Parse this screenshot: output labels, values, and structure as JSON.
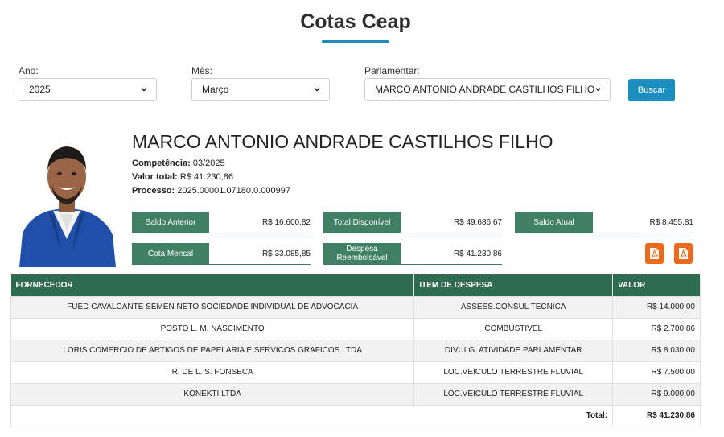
{
  "page": {
    "title": "Cotas Ceap"
  },
  "filters": {
    "ano": {
      "label": "Ano:",
      "value": "2025"
    },
    "mes": {
      "label": "Mês:",
      "value": "Março"
    },
    "parlamentar": {
      "label": "Parlamentar:",
      "value": "MARCO ANTONIO ANDRADE CASTILHOS FILHO"
    },
    "search_button": "Buscar"
  },
  "profile": {
    "name": "MARCO ANTONIO ANDRADE CASTILHOS FILHO",
    "competencia_label": "Competência:",
    "competencia": "03/2025",
    "valor_total_label": "Valor total:",
    "valor_total": "R$ 41.230,86",
    "processo_label": "Processo:",
    "processo": "2025.00001.07180.0.000997"
  },
  "stats": {
    "saldo_anterior": {
      "label": "Saldo Anterior",
      "value": "R$ 16.600,82"
    },
    "total_disponivel": {
      "label": "Total Disponível",
      "value": "R$ 49.686,67"
    },
    "saldo_atual": {
      "label": "Saldo Atual",
      "value": "R$ 8.455,81"
    },
    "cota_mensal": {
      "label": "Cota Mensal",
      "value": "R$ 33.085,85"
    },
    "despesa_reembolsavel": {
      "label_line1": "Despesa",
      "label_line2": "Reembolsável",
      "value": "R$ 41.230,86"
    }
  },
  "table": {
    "headers": {
      "fornecedor": "FORNECEDOR",
      "item": "ITEM DE DESPESA",
      "valor": "VALOR"
    },
    "rows": [
      {
        "fornecedor": "FUED CAVALCANTE SEMEN NETO SOCIEDADE INDIVIDUAL DE ADVOCACIA",
        "item": "ASSESS.CONSUL TECNICA",
        "valor": "R$ 14.000,00"
      },
      {
        "fornecedor": "POSTO L. M. NASCIMENTO",
        "item": "COMBUSTIVEL",
        "valor": "R$ 2.700,86"
      },
      {
        "fornecedor": "LORIS COMERCIO DE ARTIGOS DE PAPELARIA E SERVICOS GRAFICOS LTDA",
        "item": "DIVULG. ATIVIDADE PARLAMENTAR",
        "valor": "R$ 8.030,00"
      },
      {
        "fornecedor": "R. DE L. S. FONSECA",
        "item": "LOC.VEICULO TERRESTRE FLUVIAL",
        "valor": "R$ 7.500,00"
      },
      {
        "fornecedor": "KONEKTI LTDA",
        "item": "LOC.VEICULO TERRESTRE FLUVIAL",
        "valor": "R$ 9.000,00"
      }
    ],
    "total_label": "Total:",
    "total_value": "R$ 41.230,86"
  },
  "colors": {
    "accent": "#1a8fbf",
    "green": "#3f7f63",
    "header_green": "#2f6b4f",
    "pdf_orange": "#e86a1a"
  },
  "icons": [
    "chevron-down-icon",
    "pdf-icon"
  ]
}
